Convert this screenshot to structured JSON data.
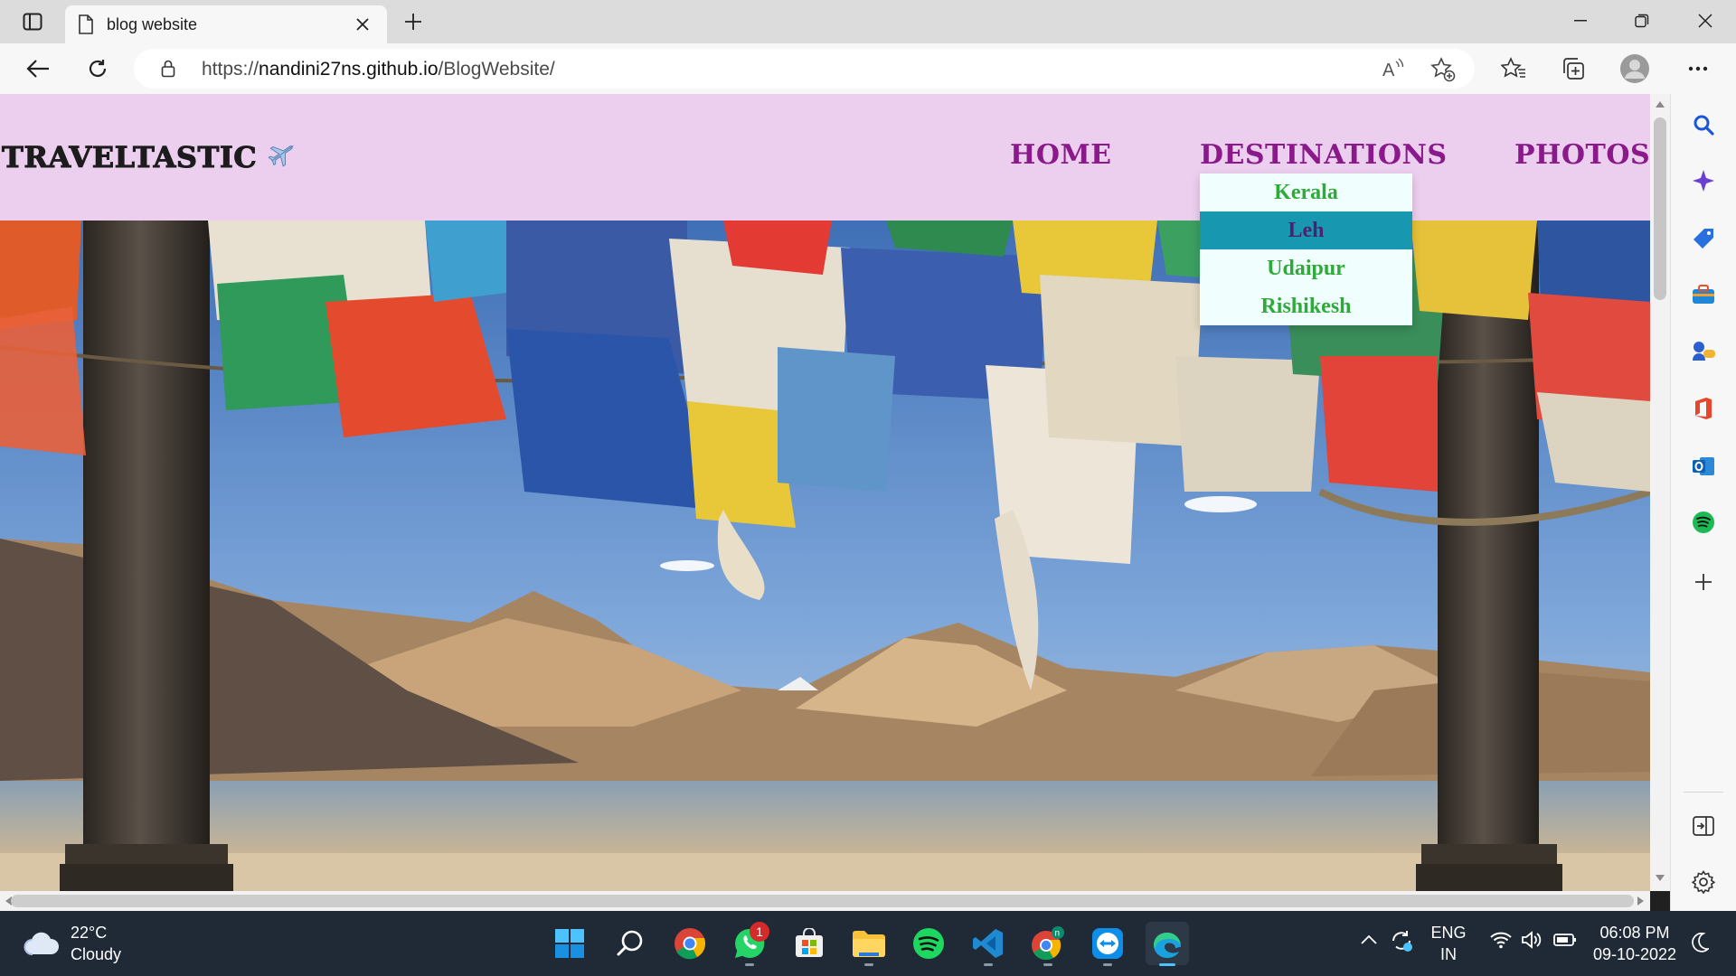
{
  "browser": {
    "tab_title": "blog website",
    "url_prefix": "https://",
    "url_host": "nandini27ns.github.io",
    "url_path": "/BlogWebsite/"
  },
  "site": {
    "logo_text": "TRAVELTASTIC",
    "logo_emoji": "✈️",
    "nav": {
      "home": "HOME",
      "destinations": "DESTINATIONS",
      "photos": "PHOTOS"
    },
    "dropdown": [
      {
        "label": "Kerala",
        "active": false
      },
      {
        "label": "Leh",
        "active": true
      },
      {
        "label": "Udaipur",
        "active": false
      },
      {
        "label": "Rishikesh",
        "active": false
      }
    ],
    "colors": {
      "header_bg": "#eccfef",
      "nav_text": "#8a1a8a",
      "dropdown_bg": "#f0fffd",
      "dropdown_text": "#2faa3a",
      "dropdown_active_bg": "#1798b0",
      "dropdown_active_text": "#4a2370"
    }
  },
  "taskbar": {
    "weather_temp": "22°C",
    "weather_desc": "Cloudy",
    "whatsapp_badge": "1",
    "lang_line1": "ENG",
    "lang_line2": "IN",
    "time": "06:08 PM",
    "date": "09-10-2022"
  }
}
